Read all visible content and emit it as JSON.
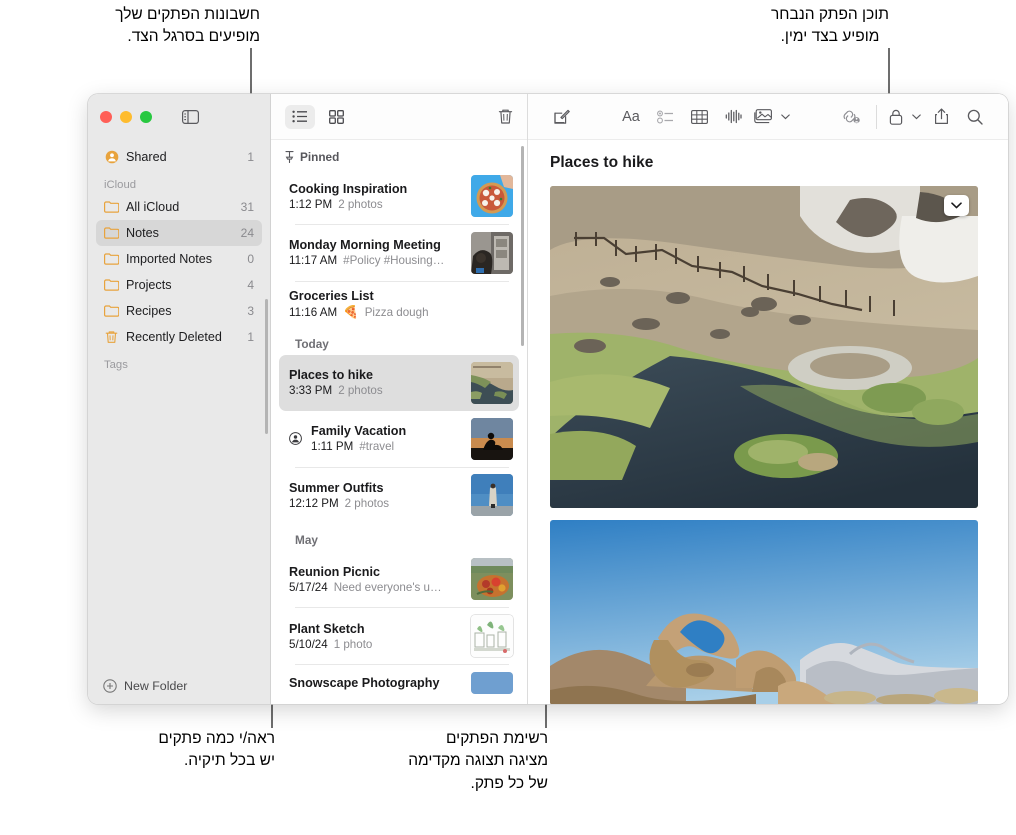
{
  "annotations": {
    "top_left": "חשבונות הפתקים שלך\nמופיעים בסרגל הצד.",
    "top_right": "תוכן הפתק הנבחר\nמופיע בצד ימין.",
    "bottom_left": "ראה/י כמה פתקים\nיש בכל תיקיה.",
    "bottom_middle": "רשימת הפתקים\nמציגה תצוגה מקדימה\nשל כל פתק."
  },
  "sidebar": {
    "window_controls": [
      "close",
      "minimize",
      "zoom"
    ],
    "toggle_icon": "sidebar-toggle-icon",
    "rows": [
      {
        "label": "Shared",
        "count": "1",
        "icon": "shared-person-icon",
        "selected": false,
        "section": false
      },
      {
        "label": "iCloud",
        "count": "",
        "icon": "",
        "selected": false,
        "section": true
      },
      {
        "label": "All iCloud",
        "count": "31",
        "icon": "folder-icon",
        "selected": false,
        "section": false
      },
      {
        "label": "Notes",
        "count": "24",
        "icon": "folder-icon",
        "selected": true,
        "section": false
      },
      {
        "label": "Imported Notes",
        "count": "0",
        "icon": "folder-icon",
        "selected": false,
        "section": false
      },
      {
        "label": "Projects",
        "count": "4",
        "icon": "folder-icon",
        "selected": false,
        "section": false
      },
      {
        "label": "Recipes",
        "count": "3",
        "icon": "folder-icon",
        "selected": false,
        "section": false
      },
      {
        "label": "Recently Deleted",
        "count": "1",
        "icon": "trash-icon",
        "selected": false,
        "section": false
      },
      {
        "label": "Tags",
        "count": "",
        "icon": "",
        "selected": false,
        "section": true
      }
    ],
    "footer": {
      "label": "New Folder",
      "icon": "plus-circle-icon"
    }
  },
  "note_list": {
    "toolbar": {
      "list_view_icon": "list-view-icon",
      "gallery_view_icon": "gallery-view-icon",
      "delete_icon": "trash-icon",
      "active_view": "list"
    },
    "groups": [
      {
        "label": "Pinned",
        "icon": "pin-icon",
        "notes": [
          {
            "title": "Cooking Inspiration",
            "time": "1:12 PM",
            "snippet": "2 photos",
            "thumb": "pizza",
            "emoji": "",
            "badge": ""
          },
          {
            "title": "Monday Morning Meeting",
            "time": "11:17 AM",
            "snippet": "#Policy #Housing…",
            "thumb": "meeting",
            "emoji": "",
            "badge": ""
          },
          {
            "title": "Groceries List",
            "time": "11:16 AM",
            "snippet": "Pizza dough",
            "thumb": "",
            "emoji": "🍕",
            "badge": ""
          }
        ]
      },
      {
        "label": "Today",
        "icon": "",
        "notes": [
          {
            "title": "Places to hike",
            "time": "3:33 PM",
            "snippet": "2 photos",
            "thumb": "hike",
            "emoji": "",
            "badge": "",
            "selected": true
          },
          {
            "title": "Family Vacation",
            "time": "1:11 PM",
            "snippet": "#travel",
            "thumb": "vacation",
            "emoji": "",
            "badge": "shared-person-icon"
          },
          {
            "title": "Summer Outfits",
            "time": "12:12 PM",
            "snippet": "2 photos",
            "thumb": "outfits",
            "emoji": "",
            "badge": ""
          }
        ]
      },
      {
        "label": "May",
        "icon": "",
        "notes": [
          {
            "title": "Reunion Picnic",
            "time": "5/17/24",
            "snippet": "Need everyone's u…",
            "thumb": "picnic",
            "emoji": "",
            "badge": ""
          },
          {
            "title": "Plant Sketch",
            "time": "5/10/24",
            "snippet": "1 photo",
            "thumb": "sketch",
            "emoji": "",
            "badge": ""
          },
          {
            "title": "Snowscape Photography",
            "time": "",
            "snippet": "",
            "thumb": "snow",
            "emoji": "",
            "badge": ""
          }
        ]
      }
    ]
  },
  "detail": {
    "toolbar_icons": [
      "compose-icon",
      "format-aa-icon",
      "checklist-icon",
      "table-icon",
      "audio-waveform-icon",
      "media-icon",
      "collaborate-link-icon",
      "lock-icon",
      "share-icon",
      "search-icon"
    ],
    "note_title": "Places to hike",
    "photos": [
      {
        "name": "hot-creek-river-photo",
        "menu_icon": "chevron-down-icon"
      },
      {
        "name": "mobius-arch-photo",
        "menu_icon": ""
      }
    ]
  },
  "colors": {
    "folder_yellow": "#e8a33d",
    "sidebar_bg": "#e9e9e9",
    "selection_gray": "#d7d7d7",
    "accent_text": "#8a8a8e"
  }
}
